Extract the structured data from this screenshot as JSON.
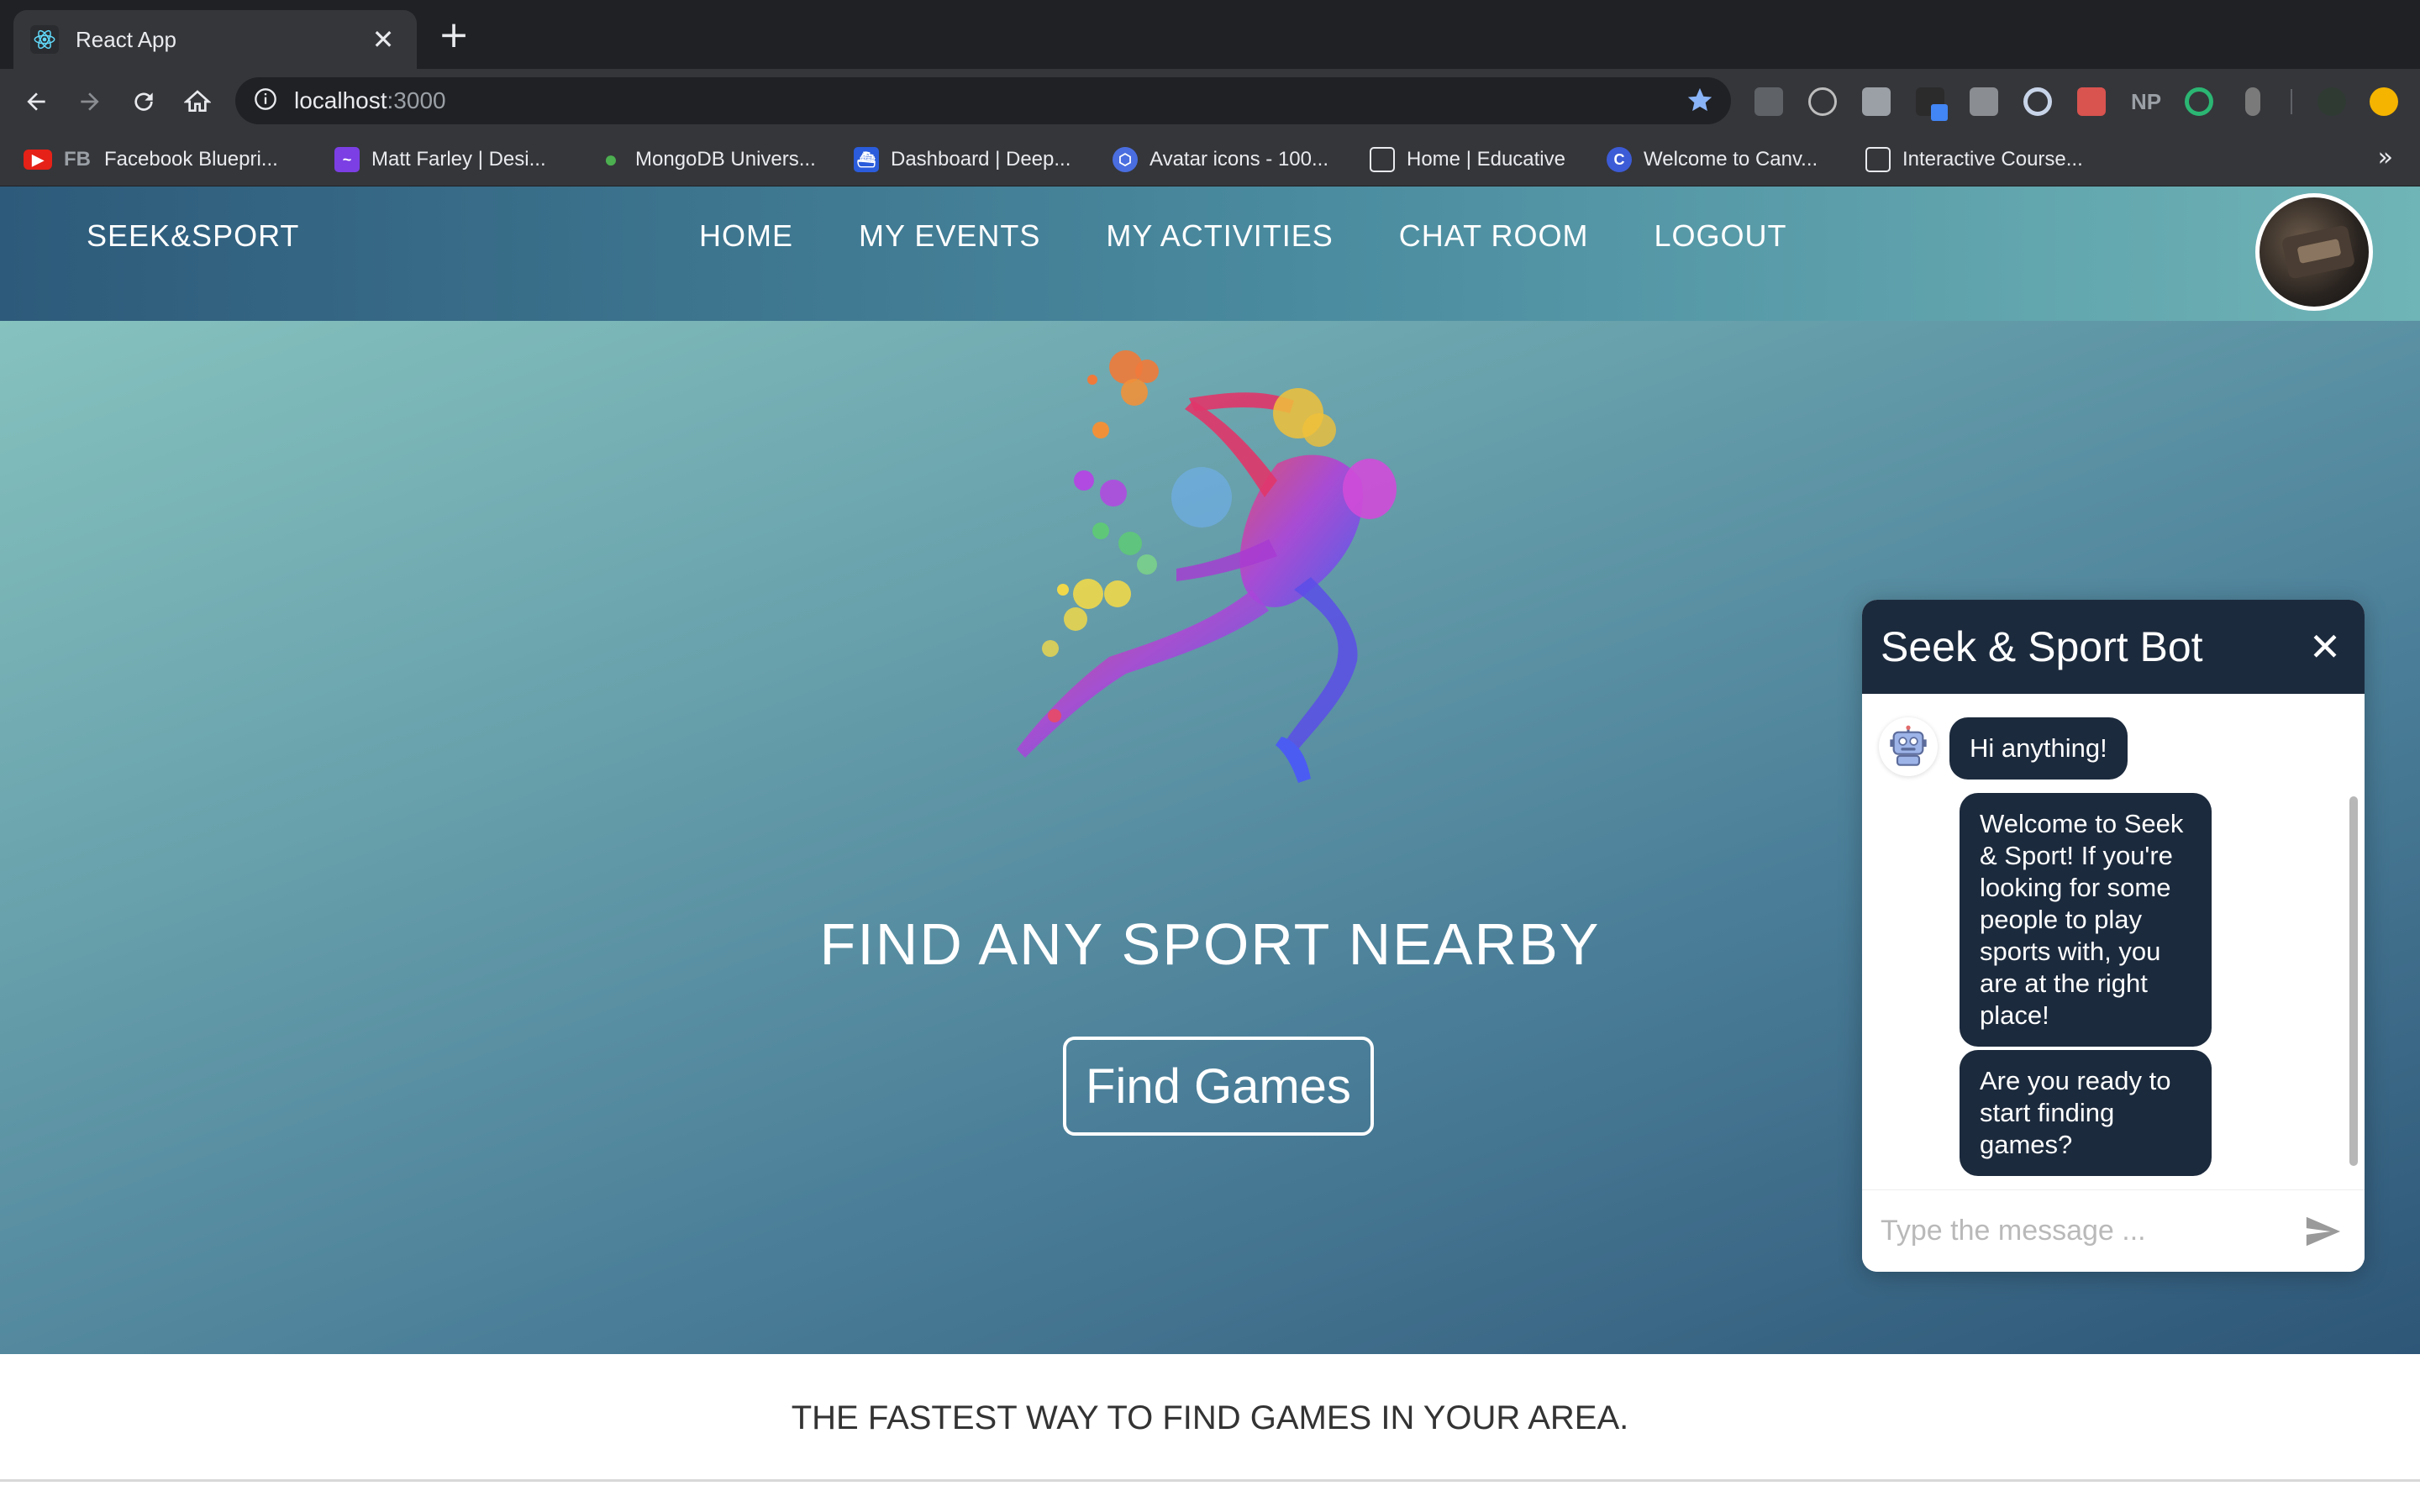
{
  "browser": {
    "tab_title": "React App",
    "tab_close": "✕",
    "new_tab": "+",
    "url_host": "localhost",
    "url_port": ":3000",
    "bookmarks": [
      {
        "label": "Facebook Bluepri...",
        "icon": "youtube-fb-icon",
        "prefix": "FB"
      },
      {
        "label": "Matt Farley | Desi...",
        "icon": "chart-icon"
      },
      {
        "label": "MongoDB Univers...",
        "icon": "leaf-icon"
      },
      {
        "label": "Dashboard | Deep...",
        "icon": "ship-icon"
      },
      {
        "label": "Avatar icons - 100...",
        "icon": "hex-icon"
      },
      {
        "label": "Home | Educative",
        "icon": "window-icon"
      },
      {
        "label": "Welcome to Canv...",
        "icon": "c-icon"
      },
      {
        "label": "Interactive Course...",
        "icon": "window-icon"
      }
    ],
    "bookmarks_more": "»"
  },
  "navbar": {
    "brand": "SEEK&SPORT",
    "links": [
      "HOME",
      "MY EVENTS",
      "MY ACTIVITIES",
      "CHAT ROOM",
      "LOGOUT"
    ]
  },
  "hero": {
    "headline": "FIND ANY SPORT NEARBY",
    "cta": "Find Games"
  },
  "tagline": "THE FASTEST WAY TO FIND GAMES IN YOUR AREA.",
  "chat": {
    "title": "Seek & Sport Bot",
    "close": "✕",
    "messages": [
      "Hi anything!",
      "Welcome to Seek & Sport! If you're looking for some people to play sports with, you are at the right place!",
      "Are you ready to start finding games?"
    ],
    "input_placeholder": "Type the message ..."
  },
  "colors": {
    "chrome_dark": "#202124",
    "chrome_toolbar": "#35363a",
    "chat_header": "#1c2a3d",
    "hero_top": "#8cc9c2",
    "hero_bottom": "#2e5677"
  }
}
